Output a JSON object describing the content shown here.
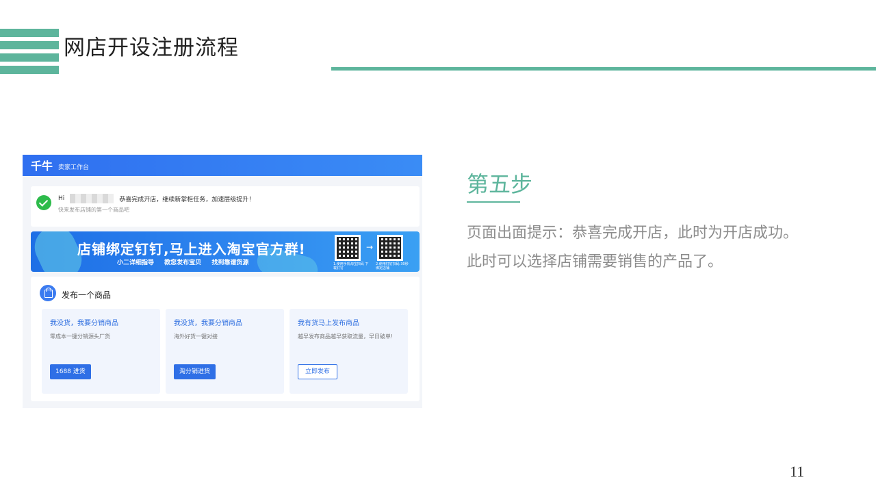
{
  "slide": {
    "title": "网店开设注册流程",
    "page_number": "11",
    "accent_color": "#5db59c"
  },
  "screenshot": {
    "brand": "千牛",
    "brand_sub": "卖家工作台",
    "welcome": {
      "greeting": "Hi",
      "message": "恭喜完成开店，继续新掌柜任务，加速层级提升！",
      "sub": "快来发布店铺的第一个商品吧"
    },
    "banner": {
      "title": "店铺绑定钉钉,马上进入淘宝官方群!",
      "subs": [
        "小二详细指导",
        "教您发布宝贝",
        "找到靠谱货源"
      ],
      "qr1_caption": "1.使用手机淘宝扫码 下载钉钉",
      "qr2_caption": "2.使用钉钉扫码 30秒绑定店铺"
    },
    "publish": {
      "title": "发布一个商品",
      "options": [
        {
          "title": "我没货，我要分销商品",
          "desc": "零成本一键分销源头厂货",
          "button": "1688 进货"
        },
        {
          "title": "我没货，我要分销商品",
          "desc": "海外好货一键对接",
          "button": "淘分销进货"
        },
        {
          "title": "我有货马上发布商品",
          "desc": "越早发布商品越早获取流量，早日破单!",
          "button": "立即发布"
        }
      ]
    }
  },
  "step": {
    "title": "第五步",
    "description": "页面出面提示：恭喜完成开店，此时为开店成功。此时可以选择店铺需要销售的产品了。"
  }
}
